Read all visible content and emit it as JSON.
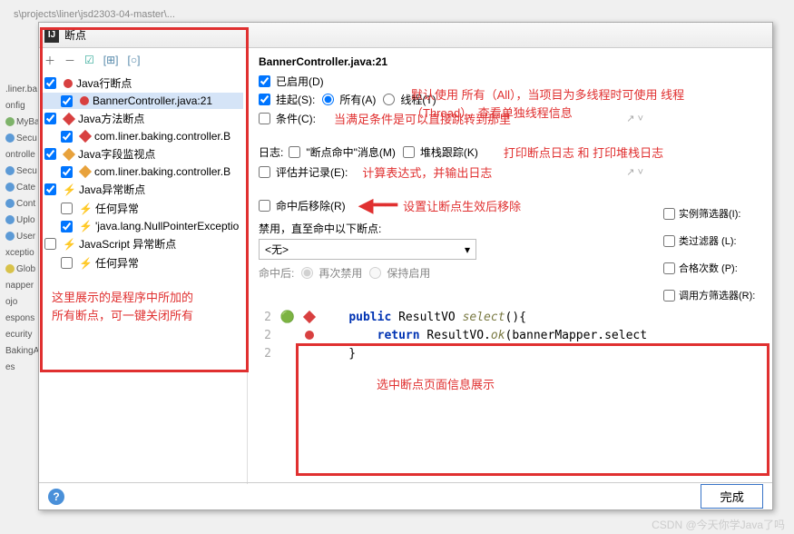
{
  "path": "s\\projects\\liner\\jsd2303-04-master\\...",
  "dialog_title": "断点",
  "left": {
    "items": [
      {
        "label": "Java行断点",
        "cls": "dot-red"
      },
      {
        "label": "BannerController.java:21",
        "cls": "dot-red",
        "sel": true,
        "indent": 20
      },
      {
        "label": "Java方法断点",
        "cls": "diamond-red"
      },
      {
        "label": "com.liner.baking.controller.B",
        "cls": "diamond-red",
        "indent": 20
      },
      {
        "label": "Java字段监视点",
        "cls": "diamond-ye"
      },
      {
        "label": "com.liner.baking.controller.B",
        "cls": "diamond-ye",
        "indent": 20
      },
      {
        "label": "Java异常断点",
        "bolt": true
      },
      {
        "label": "任何异常",
        "bolt": true,
        "indent": 20,
        "unchecked": true
      },
      {
        "label": "'java.lang.NullPointerExceptio",
        "bolt": true,
        "indent": 20
      },
      {
        "label": "JavaScript 异常断点",
        "bolt": true,
        "unchecked": true
      },
      {
        "label": "任何异常",
        "bolt": true,
        "indent": 20,
        "unchecked": true
      }
    ],
    "note1": "这里展示的是程序中所加的",
    "note2": "所有断点，可一键关闭所有"
  },
  "right": {
    "title": "BannerController.java:21",
    "enabled": "已启用(D)",
    "suspend": "挂起(S):",
    "all": "所有(A)",
    "thread": "线程(T)",
    "note_suspend": "默认使用 所有（All），当项目为多线程时可使用 线程（Thread），查看单独线程信息",
    "condition": "条件(C):",
    "note_cond": "当满足条件是可以直接跳转到那里",
    "log": "日志:",
    "hit_msg": "\"断点命中\"消息(M)",
    "stack": "堆栈跟踪(K)",
    "note_log": "打印断点日志 和 打印堆栈日志",
    "eval": "评估并记录(E):",
    "note_eval": "计算表达式，并输出日志",
    "remove": "命中后移除(R)",
    "note_remove": "设置让断点生效后移除",
    "disable_until": "禁用，直至命中以下断点:",
    "none": "<无>",
    "after": "命中后:",
    "redisable": "再次禁用",
    "keep": "保持启用",
    "instance": "实例筛选器(I):",
    "classfilter": "类过滤器  (L):",
    "passcount": "合格次数 (P):",
    "caller": "调用方筛选器(R):",
    "note_code": "选中断点页面信息展示",
    "done": "完成"
  },
  "code": {
    "l1": "public ResultVO select(){",
    "l2": "return ResultVO.ok(bannerMapper.select",
    "l3": "}"
  },
  "side": [
    "liner.ba",
    "onfig",
    "MyBa",
    "Secu",
    "ontrolle",
    "Secu",
    "Cate",
    "Cont",
    "Uplo",
    "User",
    "xceptio",
    "Glob",
    "napper",
    "ojo",
    "espons",
    "ecurity",
    "BakingA",
    "es"
  ],
  "watermark": "CSDN @今天你学Java了吗"
}
